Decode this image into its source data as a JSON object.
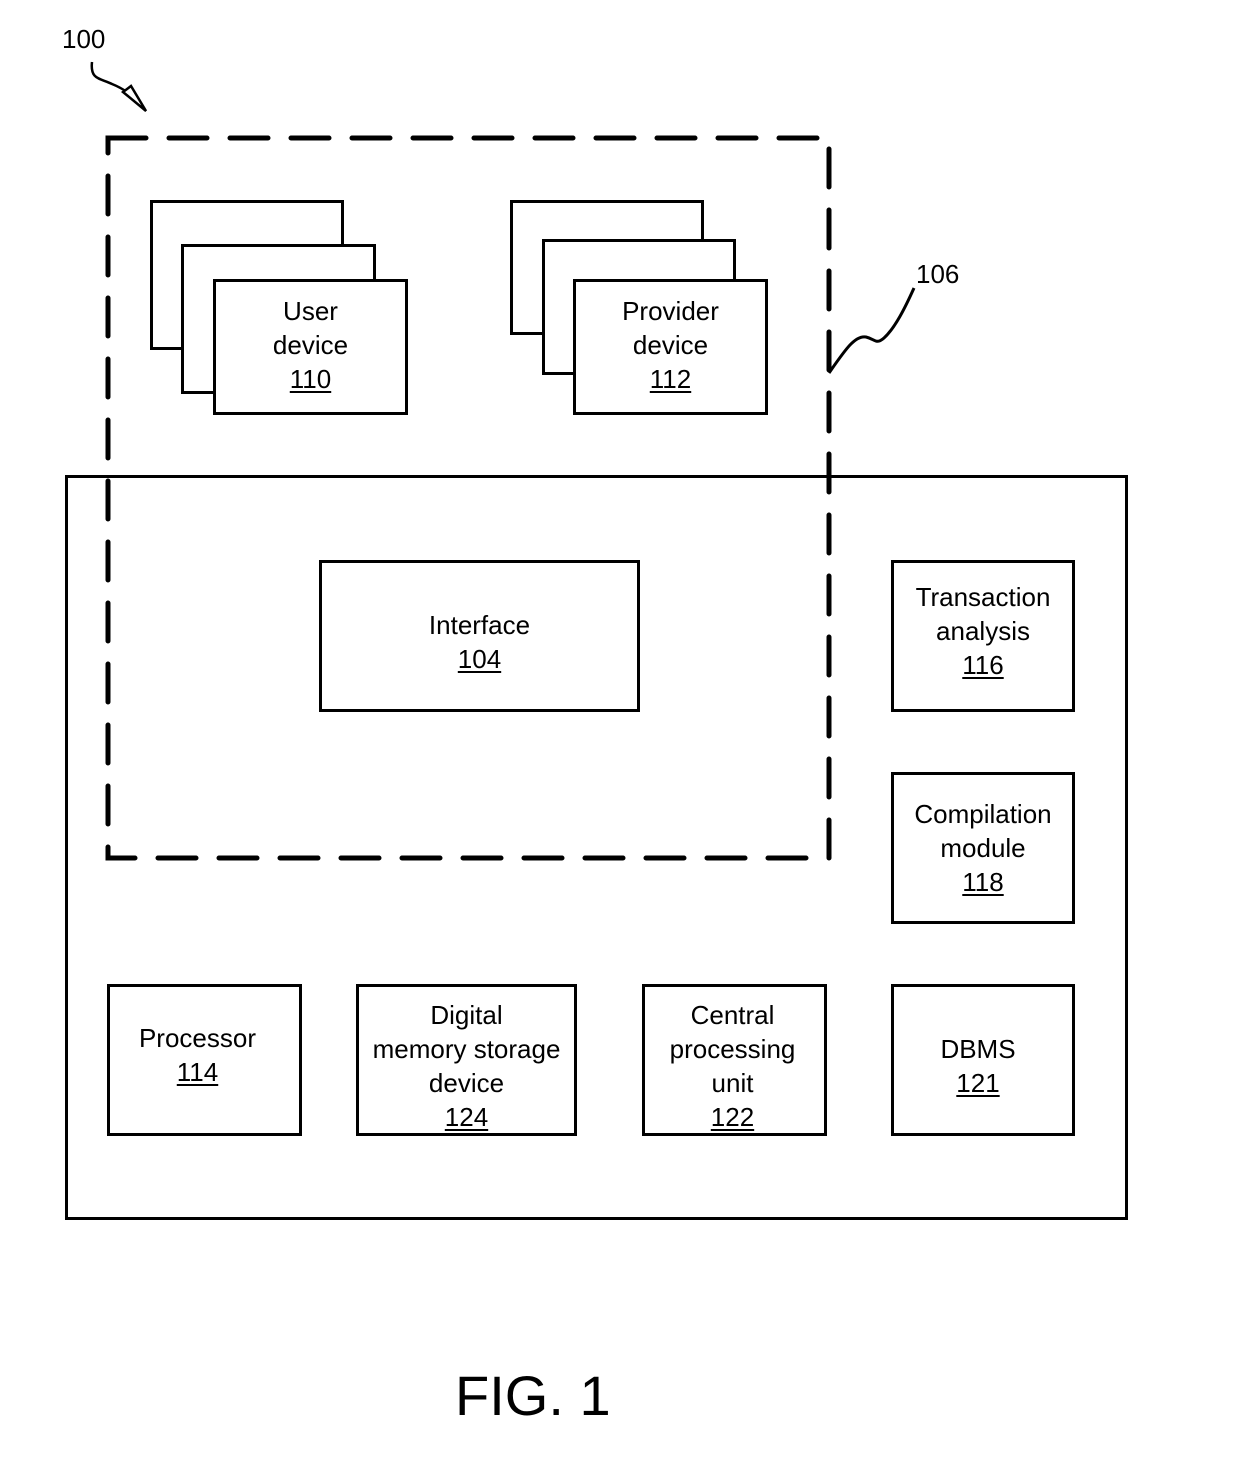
{
  "diagram": {
    "reference_label": "100",
    "network_label": "106",
    "figure_caption": "FIG. 1",
    "user_device": {
      "line1": "User",
      "line2": "device",
      "number": "110"
    },
    "provider_device": {
      "line1": "Provider",
      "line2": "device",
      "number": "112"
    },
    "interface": {
      "line1": "Interface",
      "number": "104"
    },
    "transaction_analysis": {
      "line1": "Transaction",
      "line2": "analysis",
      "number": "116"
    },
    "compilation_module": {
      "line1": "Compilation",
      "line2": "module",
      "number": "118"
    },
    "processor": {
      "line1": "Processor",
      "number": "114"
    },
    "memory_storage": {
      "line1": "Digital",
      "line2": "memory storage",
      "line3": "device",
      "number": "124"
    },
    "cpu": {
      "line1": "Central",
      "line2": "processing",
      "line3": "unit",
      "number": "122"
    },
    "dbms": {
      "line1": "DBMS",
      "number": "121"
    }
  }
}
